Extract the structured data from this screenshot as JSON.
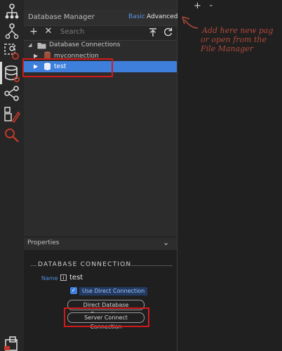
{
  "panel": {
    "title": "Database Manager",
    "modes": {
      "basic": "Basic",
      "advanced": "Advanced"
    },
    "toolbar": {
      "add_icon": "plus-icon",
      "close_icon": "close-icon",
      "search_placeholder": "Search",
      "export_icon": "upload-icon",
      "refresh_icon": "refresh-icon"
    },
    "tree": {
      "root_label": "Database Connections",
      "items": [
        {
          "label": "myconnection"
        },
        {
          "label": "test",
          "selected": true
        }
      ]
    }
  },
  "properties": {
    "header": "Properties",
    "section_title": "DATABASE CONNECTION",
    "name_label": "Name",
    "name_value": "test",
    "use_direct_label": "Use Direct Connection",
    "direct_label": "Direct Database Connection",
    "server_connect_label": "Server Connect Connection"
  },
  "annotation": {
    "lines": [
      "Add here new pag",
      "or open from the",
      "File Manager"
    ]
  },
  "top_toolbar": {
    "add_icon": "plus-icon",
    "dropdown_icon": "chevron-down-icon"
  },
  "colors": {
    "accent": "#3f7fdc",
    "highlight": "#d01a1a",
    "rail_icon": "#d9d9d9",
    "annotation": "#b04a3a"
  }
}
